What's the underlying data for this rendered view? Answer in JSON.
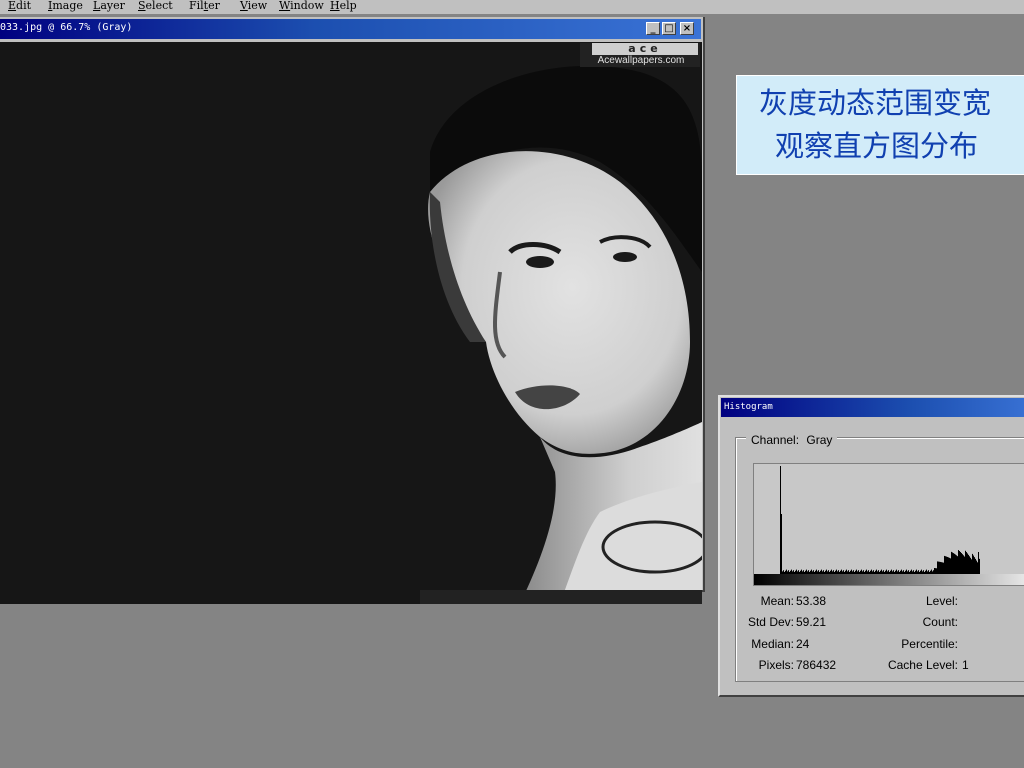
{
  "menu": [
    {
      "accel": "E",
      "rest": "dit"
    },
    {
      "accel": "I",
      "rest": "mage"
    },
    {
      "accel": "L",
      "rest": "ayer"
    },
    {
      "accel": "S",
      "rest": "elect"
    },
    {
      "pre": "Fil",
      "accel": "t",
      "rest": "er"
    },
    {
      "accel": "V",
      "rest": "iew"
    },
    {
      "accel": "W",
      "rest": "indow"
    },
    {
      "accel": "H",
      "rest": "elp"
    }
  ],
  "document_window": {
    "title": "033.jpg @ 66.7% (Gray)",
    "buttons": {
      "minimize": "_",
      "maximize": "□",
      "close": "×"
    },
    "watermark": {
      "logo": "ace",
      "site": "Acewallpapers.com"
    }
  },
  "caption": {
    "line1": "灰度动态范围变宽",
    "line2": "观察直方图分布"
  },
  "histogram": {
    "title": "Histogram",
    "channel_label": "Channel:",
    "channel_value": "Gray",
    "stats_left": [
      {
        "label": "Mean:",
        "value": "53.38"
      },
      {
        "label": "Std Dev:",
        "value": "59.21"
      },
      {
        "label": "Median:",
        "value": "24"
      },
      {
        "label": "Pixels:",
        "value": "786432"
      }
    ],
    "stats_right": [
      {
        "label": "Level:",
        "value": ""
      },
      {
        "label": "Count:",
        "value": ""
      },
      {
        "label": "Percentile:",
        "value": ""
      },
      {
        "label": "Cache Level:",
        "value": "1"
      }
    ]
  },
  "colors": {
    "titlebar_active": "#000080",
    "caption_text": "#1040b0",
    "caption_bg": "#d2ecf9",
    "workspace_bg": "#848484"
  }
}
